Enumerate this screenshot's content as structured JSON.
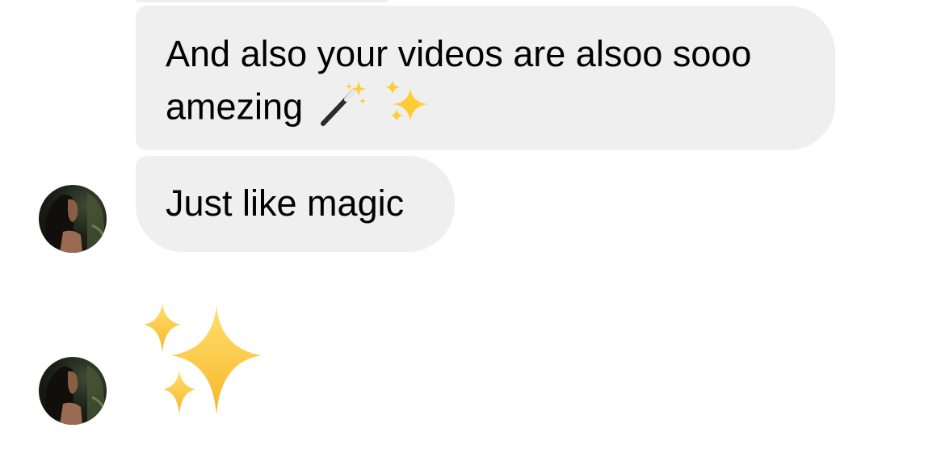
{
  "conversation": {
    "messages": [
      {
        "lines": [
          "And also your videos are alsoo sooo",
          "amezing"
        ],
        "emoji": [
          "magic-wand",
          "sparkles"
        ]
      },
      {
        "text": "Just like magic"
      },
      {
        "emoji": "sparkles"
      }
    ]
  },
  "theme": {
    "bubble_color": "#efefef",
    "text_color": "#000000",
    "background": "#ffffff",
    "sparkle_color": "#ffcc33"
  }
}
